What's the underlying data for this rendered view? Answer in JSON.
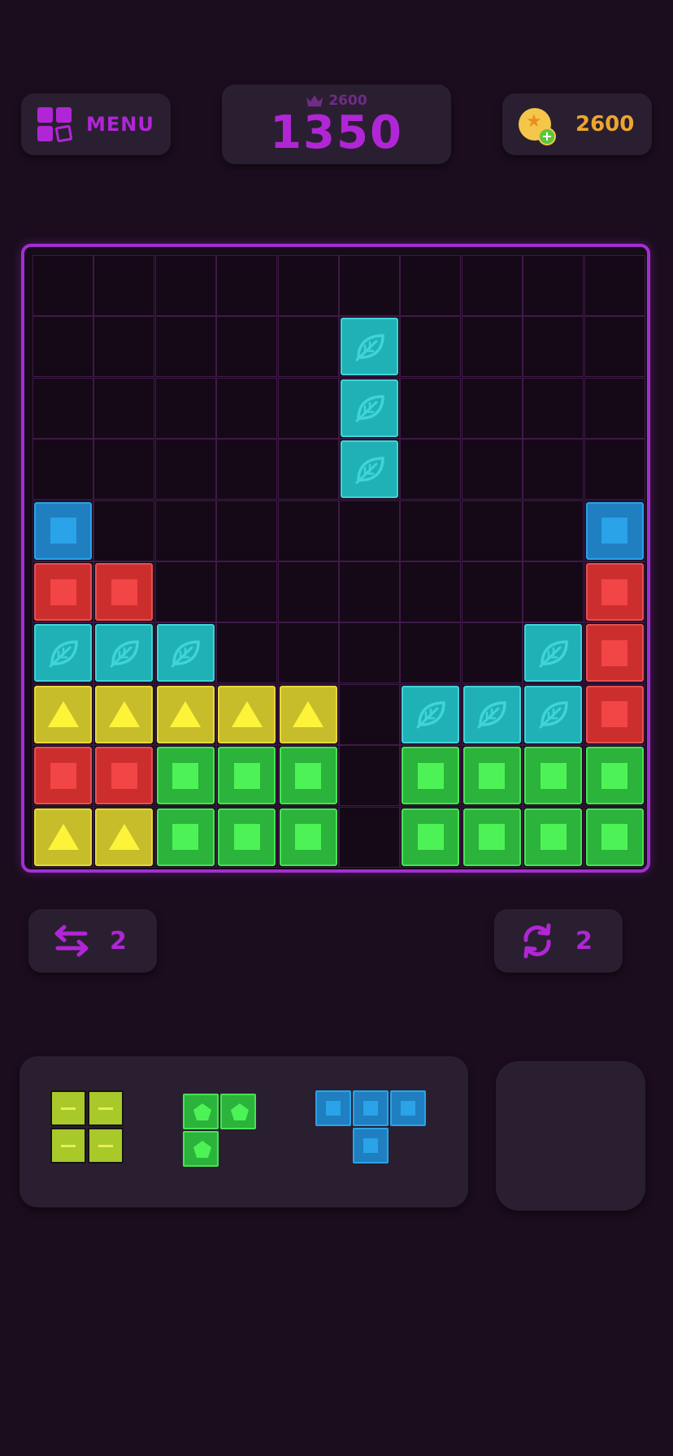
{
  "header": {
    "menu_label": "MENU",
    "best_score": "2600",
    "score": "1350",
    "coins": "2600"
  },
  "powerups": {
    "swap_count": "2",
    "rotate_count": "2"
  },
  "board": {
    "size": 10,
    "blocks": [
      {
        "row": 1,
        "col": 5,
        "color": "cyan"
      },
      {
        "row": 2,
        "col": 5,
        "color": "cyan"
      },
      {
        "row": 3,
        "col": 5,
        "color": "cyan"
      },
      {
        "row": 4,
        "col": 0,
        "color": "blue"
      },
      {
        "row": 4,
        "col": 9,
        "color": "blue"
      },
      {
        "row": 5,
        "col": 0,
        "color": "red"
      },
      {
        "row": 5,
        "col": 1,
        "color": "red"
      },
      {
        "row": 5,
        "col": 9,
        "color": "red"
      },
      {
        "row": 6,
        "col": 0,
        "color": "cyan"
      },
      {
        "row": 6,
        "col": 1,
        "color": "cyan"
      },
      {
        "row": 6,
        "col": 2,
        "color": "cyan"
      },
      {
        "row": 6,
        "col": 8,
        "color": "cyan"
      },
      {
        "row": 6,
        "col": 9,
        "color": "red"
      },
      {
        "row": 7,
        "col": 0,
        "color": "yellow"
      },
      {
        "row": 7,
        "col": 1,
        "color": "yellow"
      },
      {
        "row": 7,
        "col": 2,
        "color": "yellow"
      },
      {
        "row": 7,
        "col": 3,
        "color": "yellow"
      },
      {
        "row": 7,
        "col": 4,
        "color": "yellow"
      },
      {
        "row": 7,
        "col": 6,
        "color": "cyan"
      },
      {
        "row": 7,
        "col": 7,
        "color": "cyan"
      },
      {
        "row": 7,
        "col": 8,
        "color": "cyan"
      },
      {
        "row": 7,
        "col": 9,
        "color": "red"
      },
      {
        "row": 8,
        "col": 0,
        "color": "red"
      },
      {
        "row": 8,
        "col": 1,
        "color": "red"
      },
      {
        "row": 8,
        "col": 2,
        "color": "green"
      },
      {
        "row": 8,
        "col": 3,
        "color": "green"
      },
      {
        "row": 8,
        "col": 4,
        "color": "green"
      },
      {
        "row": 8,
        "col": 6,
        "color": "green"
      },
      {
        "row": 8,
        "col": 7,
        "color": "green"
      },
      {
        "row": 8,
        "col": 8,
        "color": "green"
      },
      {
        "row": 8,
        "col": 9,
        "color": "green"
      },
      {
        "row": 9,
        "col": 0,
        "color": "yellow"
      },
      {
        "row": 9,
        "col": 1,
        "color": "yellow"
      },
      {
        "row": 9,
        "col": 2,
        "color": "green"
      },
      {
        "row": 9,
        "col": 3,
        "color": "green"
      },
      {
        "row": 9,
        "col": 4,
        "color": "green"
      },
      {
        "row": 9,
        "col": 6,
        "color": "green"
      },
      {
        "row": 9,
        "col": 7,
        "color": "green"
      },
      {
        "row": 9,
        "col": 8,
        "color": "green"
      },
      {
        "row": 9,
        "col": 9,
        "color": "green"
      }
    ]
  },
  "tray": {
    "pieces": [
      {
        "name": "lime-square-piece",
        "style": "lime",
        "cells": [
          [
            0,
            0
          ],
          [
            0,
            1
          ],
          [
            1,
            0
          ],
          [
            1,
            1
          ]
        ]
      },
      {
        "name": "green-corner-piece",
        "style": "gpent",
        "cells": [
          [
            0,
            0
          ],
          [
            0,
            1
          ],
          [
            1,
            0
          ]
        ]
      },
      {
        "name": "blue-t-piece",
        "style": "bsq",
        "cells": [
          [
            0,
            0
          ],
          [
            0,
            1
          ],
          [
            0,
            2
          ],
          [
            1,
            1
          ]
        ]
      }
    ]
  },
  "colors": {
    "accent": "#b026d6",
    "coin": "#eda52e",
    "red": "#cc2e2e",
    "blue": "#1f7fc0",
    "green": "#2bb33b",
    "yellow": "#c7bd2b",
    "cyan": "#1fb1b6"
  },
  "icons": [
    "menu-grid-icon",
    "crown-icon",
    "coin-icon",
    "swap-arrows-icon",
    "rotate-icon",
    "leaf-icon",
    "triangle-icon",
    "pentagon-icon"
  ]
}
